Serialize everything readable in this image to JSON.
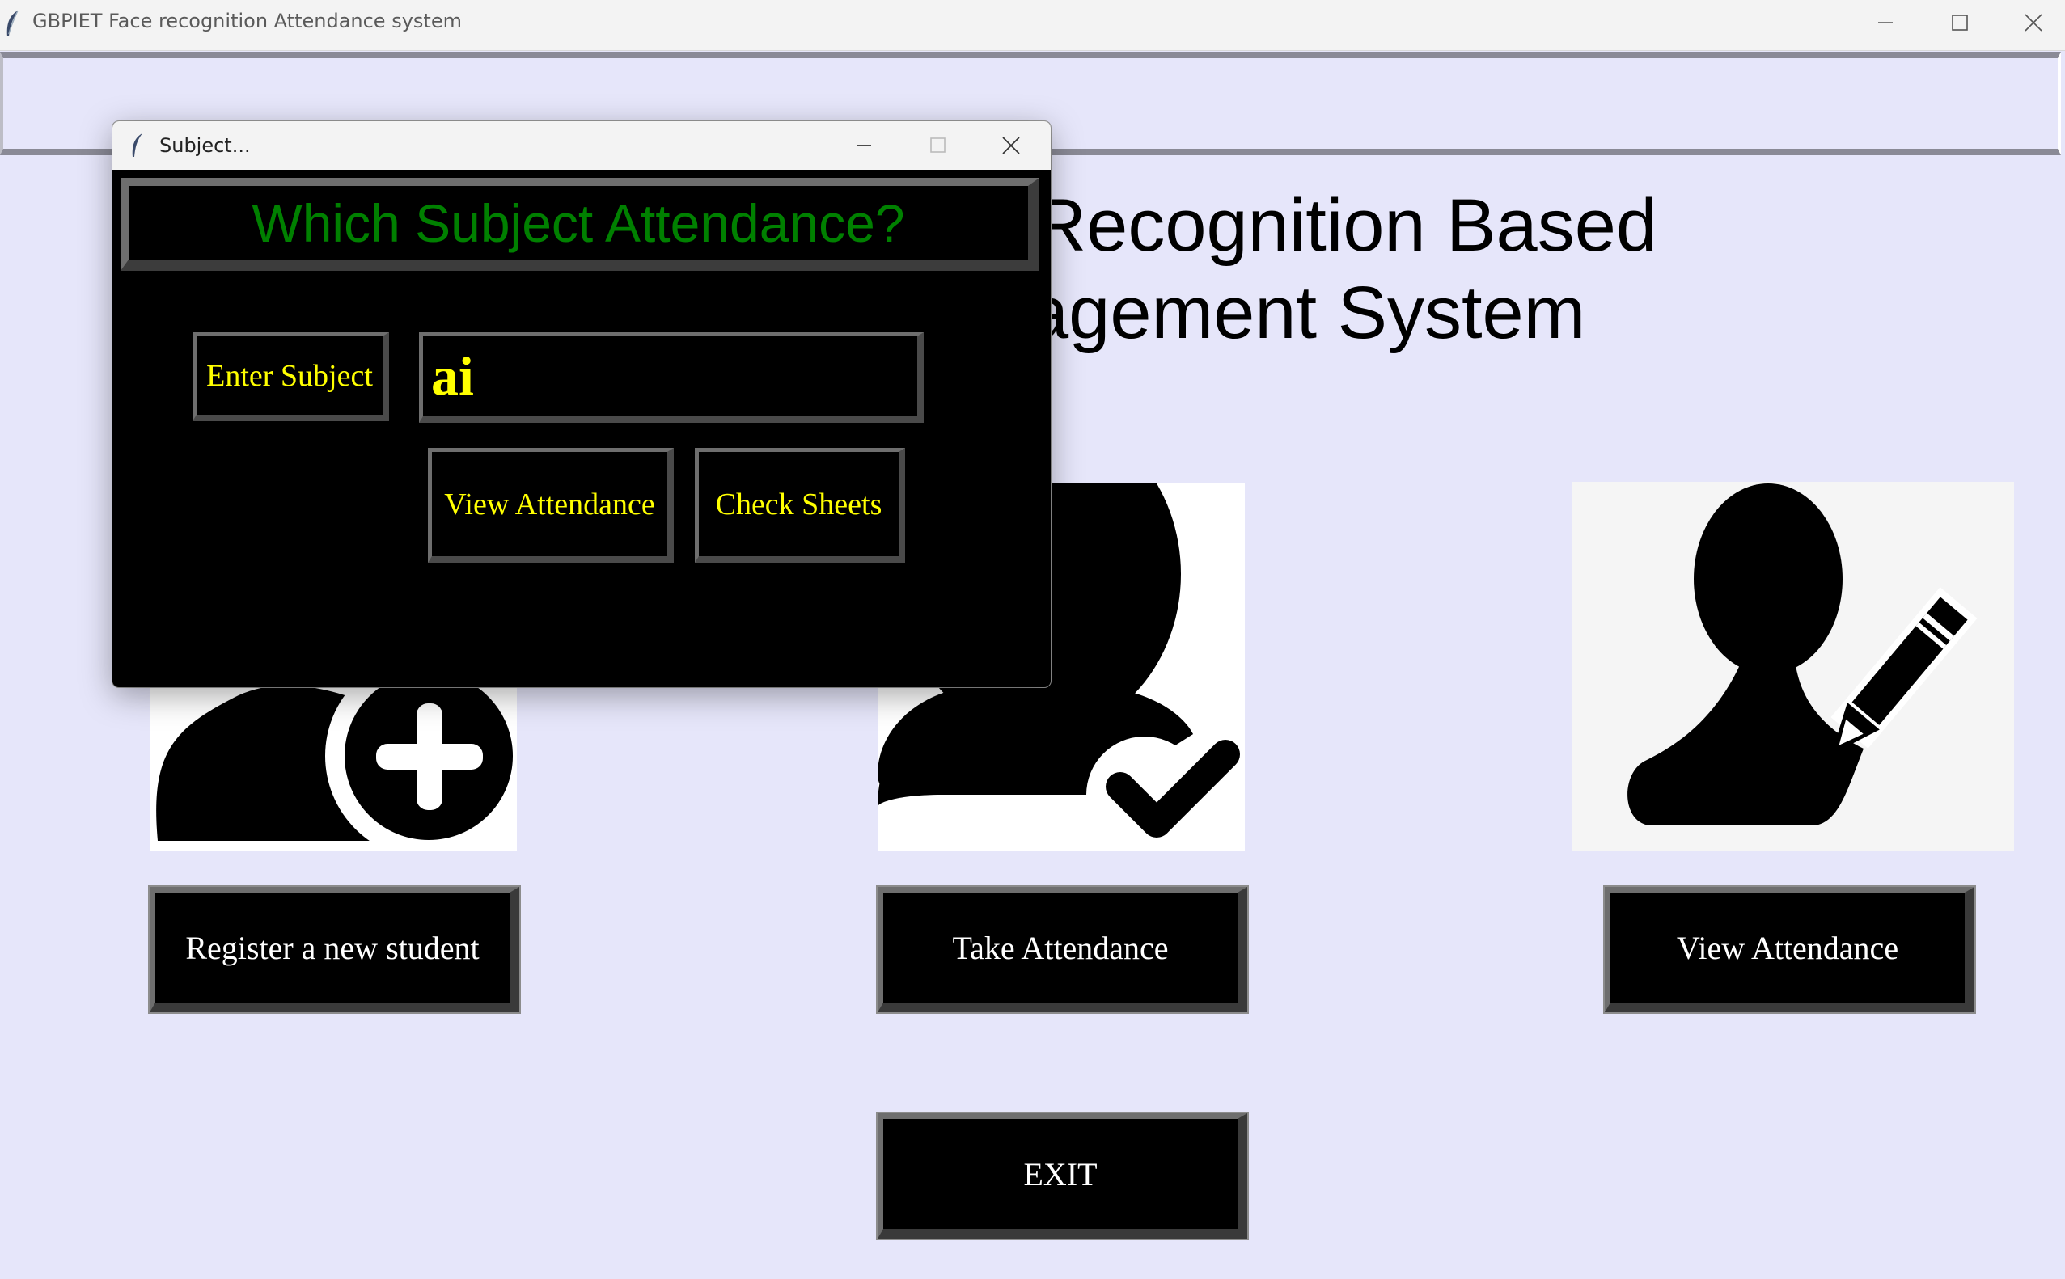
{
  "window": {
    "title": "GBPIET Face recognition Attendance system"
  },
  "main": {
    "heading_line1": "e Recognition Based",
    "heading_line2": "agement System",
    "buttons": {
      "register": "Register a new student",
      "take_attendance": "Take Attendance",
      "view_attendance": "View Attendance",
      "exit": "EXIT"
    },
    "tiles": {
      "register_icon": "user-add-icon",
      "take_icon": "user-check-icon",
      "view_icon": "user-edit-icon"
    }
  },
  "dialog": {
    "title": "Subject...",
    "header": "Which Subject Attendance?",
    "subject_label": "Enter Subject",
    "subject_value": "ai",
    "view_attendance": "View Attendance",
    "check_sheets": "Check Sheets"
  },
  "colors": {
    "background": "#e6e6fa",
    "dialog_bg": "#000000",
    "header_text": "#008000",
    "dialog_text": "#ffff00",
    "button_text": "#ffffff"
  }
}
